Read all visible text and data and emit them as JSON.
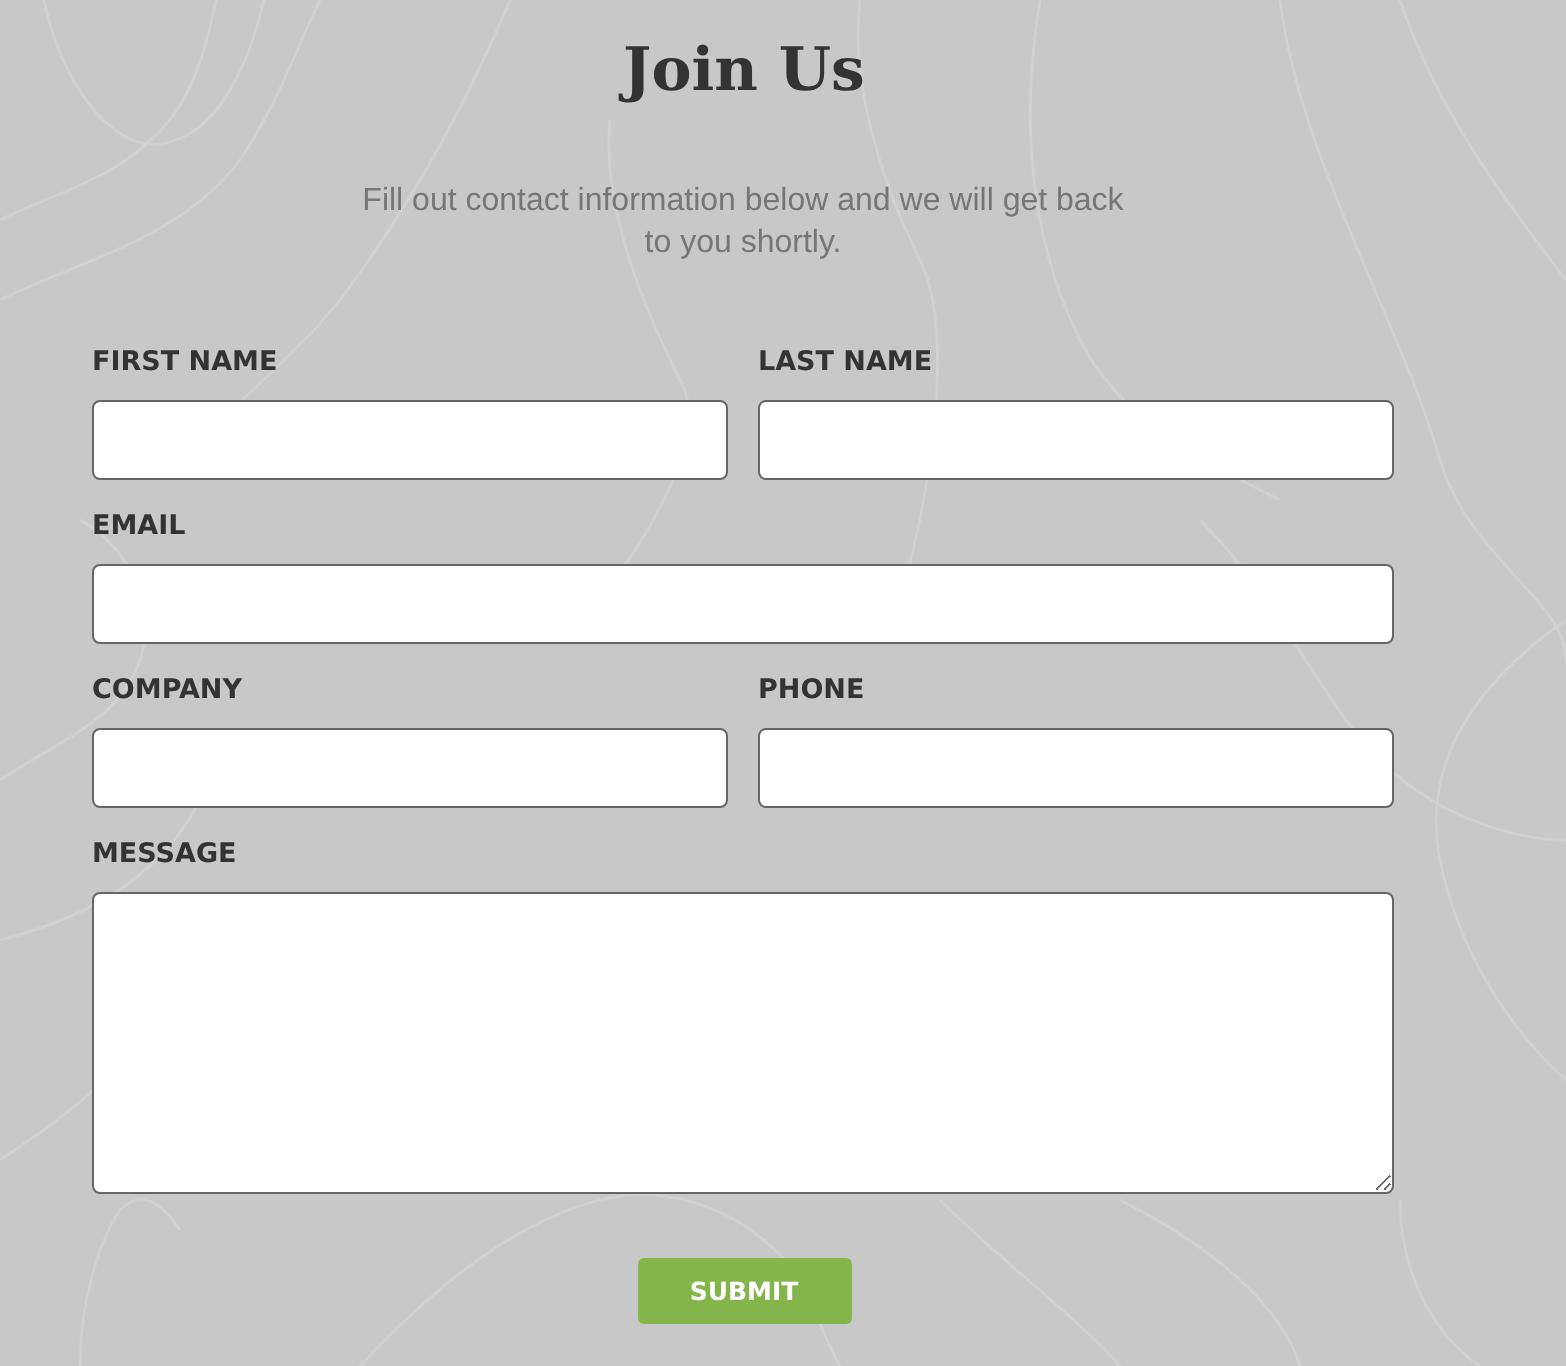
{
  "title": "Join Us",
  "subtitle": "Fill out contact information below and we will get back to you shortly.",
  "form": {
    "rows": [
      [
        {
          "label": "FIRST NAME",
          "kind": "input"
        },
        {
          "label": "LAST NAME",
          "kind": "input"
        }
      ],
      [
        {
          "label": "EMAIL",
          "kind": "input"
        }
      ],
      [
        {
          "label": "COMPANY",
          "kind": "input"
        },
        {
          "label": "PHONE",
          "kind": "input"
        }
      ],
      [
        {
          "label": "MESSAGE",
          "kind": "textarea"
        }
      ]
    ],
    "submit": "SUBMIT"
  }
}
